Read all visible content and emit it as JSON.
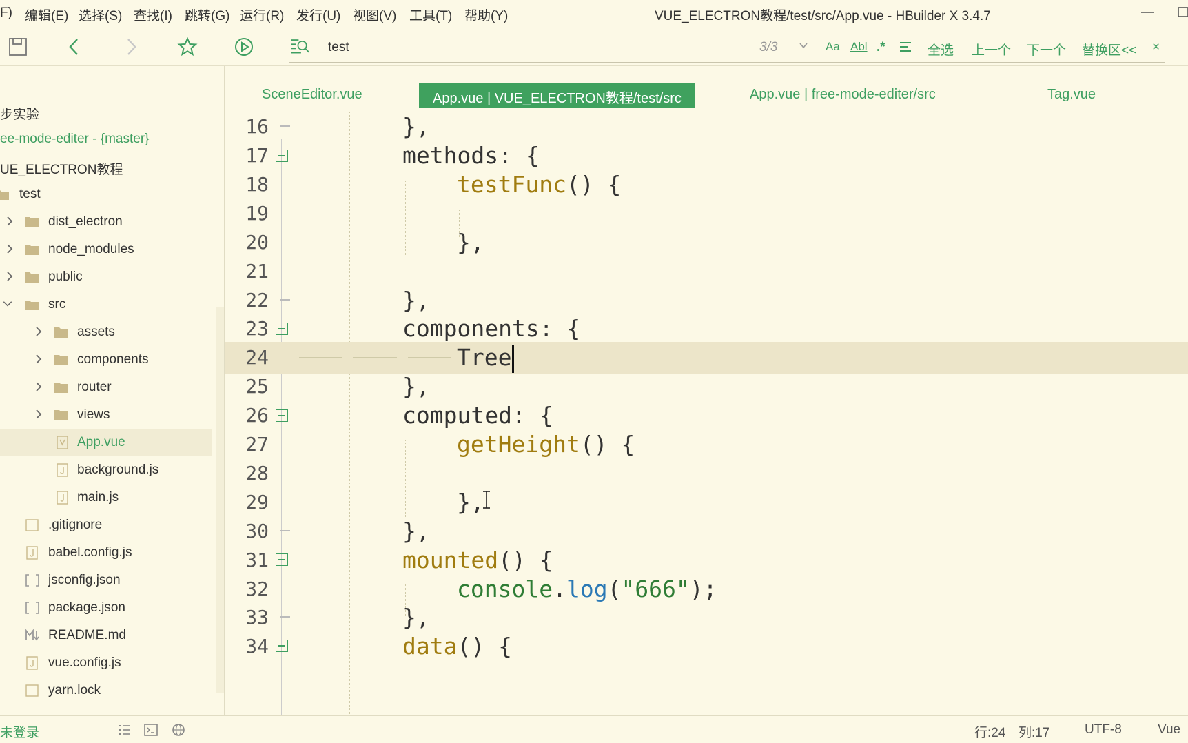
{
  "menu": {
    "items": [
      "F)",
      "编辑(E)",
      "选择(S)",
      "查找(I)",
      "跳转(G)",
      "运行(R)",
      "发行(U)",
      "视图(V)",
      "工具(T)",
      "帮助(Y)"
    ],
    "window_title": "VUE_ELECTRON教程/test/src/App.vue - HBuilder X 3.4.7"
  },
  "toolbar": {
    "icons": [
      "save-icon",
      "back-icon",
      "forward-icon",
      "star-icon",
      "run-icon",
      "find-icon"
    ]
  },
  "find": {
    "value": "test",
    "count": "3/3",
    "case_label": "Aa",
    "word_label": "Abl",
    "regex_label": ".*",
    "select_all": "全选",
    "prev": "上一个",
    "next": "下一个",
    "replace": "替换区<<",
    "close": "×"
  },
  "sidebar": {
    "items": [
      {
        "label": "步实验",
        "depth": 0,
        "type": "project"
      },
      {
        "label": "ee-mode-editer - {master}",
        "depth": 0,
        "type": "project-git"
      },
      {
        "label": "UE_ELECTRON教程",
        "depth": 0,
        "type": "project"
      },
      {
        "label": "test",
        "depth": 0,
        "type": "folder-open"
      },
      {
        "label": "dist_electron",
        "depth": 1,
        "type": "folder"
      },
      {
        "label": "node_modules",
        "depth": 1,
        "type": "folder"
      },
      {
        "label": "public",
        "depth": 1,
        "type": "folder"
      },
      {
        "label": "src",
        "depth": 1,
        "type": "folder-open"
      },
      {
        "label": "assets",
        "depth": 2,
        "type": "folder"
      },
      {
        "label": "components",
        "depth": 2,
        "type": "folder"
      },
      {
        "label": "router",
        "depth": 2,
        "type": "folder"
      },
      {
        "label": "views",
        "depth": 2,
        "type": "folder"
      },
      {
        "label": "App.vue",
        "depth": 2,
        "type": "vue",
        "active": true
      },
      {
        "label": "background.js",
        "depth": 2,
        "type": "js"
      },
      {
        "label": "main.js",
        "depth": 2,
        "type": "js"
      },
      {
        "label": ".gitignore",
        "depth": 1,
        "type": "file"
      },
      {
        "label": "babel.config.js",
        "depth": 1,
        "type": "js"
      },
      {
        "label": "jsconfig.json",
        "depth": 1,
        "type": "json"
      },
      {
        "label": "package.json",
        "depth": 1,
        "type": "json"
      },
      {
        "label": "README.md",
        "depth": 1,
        "type": "md"
      },
      {
        "label": "vue.config.js",
        "depth": 1,
        "type": "js"
      },
      {
        "label": "yarn.lock",
        "depth": 1,
        "type": "file"
      }
    ]
  },
  "tabs": [
    {
      "label": "SceneEditor.vue",
      "active": false
    },
    {
      "label": "App.vue | VUE_ELECTRON教程/test/src",
      "active": true
    },
    {
      "label": "App.vue | free-mode-editer/src",
      "active": false
    },
    {
      "label": "Tag.vue",
      "active": false
    }
  ],
  "code": {
    "lines": [
      {
        "n": "16",
        "text": "    },"
      },
      {
        "n": "17",
        "text": "    methods: {"
      },
      {
        "n": "18",
        "text": "        testFunc() {"
      },
      {
        "n": "19",
        "text": ""
      },
      {
        "n": "20",
        "text": "        },"
      },
      {
        "n": "21",
        "text": ""
      },
      {
        "n": "22",
        "text": "    },"
      },
      {
        "n": "23",
        "text": "    components: {"
      },
      {
        "n": "24",
        "text": "        Tree"
      },
      {
        "n": "25",
        "text": "    },"
      },
      {
        "n": "26",
        "text": "    computed: {"
      },
      {
        "n": "27",
        "text": "        getHeight() {"
      },
      {
        "n": "28",
        "text": ""
      },
      {
        "n": "29",
        "text": "        },"
      },
      {
        "n": "30",
        "text": "    },"
      },
      {
        "n": "31",
        "text": "    mounted() {"
      },
      {
        "n": "32",
        "text": "        console.log(\"666\");"
      },
      {
        "n": "33",
        "text": "    },"
      },
      {
        "n": "34",
        "text": "    data() {"
      }
    ],
    "tokens": {
      "methods": "methods",
      "testFunc": "testFunc",
      "components": "components",
      "Tree": "Tree",
      "computed": "computed",
      "getHeight": "getHeight",
      "mounted": "mounted",
      "console": "console",
      "log": "log",
      "str666": "\"666\"",
      "data": "data"
    }
  },
  "status": {
    "login": "未登录",
    "line": "行:24",
    "col": "列:17",
    "encoding": "UTF-8",
    "language": "Vue"
  },
  "colors": {
    "accent": "#3fa15e",
    "background": "#fcf9e6",
    "current_line": "#ece5c9",
    "function": "#a07c10",
    "method": "#2b79b5"
  }
}
